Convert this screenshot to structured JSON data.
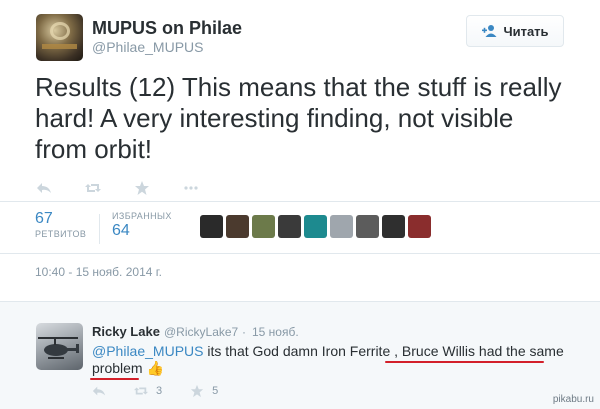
{
  "tweet": {
    "author_name": "MUPUS on Philae",
    "author_handle": "@Philae_MUPUS",
    "follow_label": "Читать",
    "text": "Results (12) This means that the stuff is really hard! A very interesting finding, not visible from orbit!",
    "retweets_count": "67",
    "retweets_label": "РЕТВИТОВ",
    "favorites_label": "ИЗБРАННЫХ",
    "favorites_count": "64",
    "timestamp": "10:40 - 15 нояб. 2014 г.",
    "actions": [
      "reply-icon",
      "retweet-icon",
      "favorite-icon",
      "more-icon"
    ],
    "face_colors": [
      "#2a2a2a",
      "#4b3a2e",
      "#6c7a4a",
      "#3a3a3a",
      "#1d8a8f",
      "#9fa6ad",
      "#5c5c5c",
      "#2f2f2f",
      "#8a2d2d"
    ]
  },
  "reply": {
    "author_name": "Ricky Lake",
    "author_handle": "@RickyLake7",
    "separator": "·",
    "date": "15 нояб.",
    "mention": "@Philae_MUPUS",
    "text_part1": " its that God damn Iron Ferrite , ",
    "highlighted_1": "Bruce Willis had the same",
    "highlighted_2": "problem",
    "emoji": "👍",
    "retweets": "3",
    "favorites": "5"
  },
  "watermark": "pikabu.ru"
}
